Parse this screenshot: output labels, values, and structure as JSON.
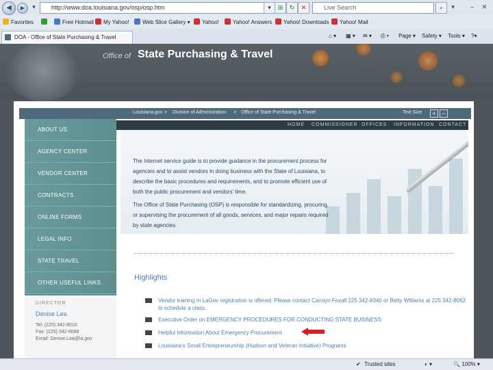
{
  "browser": {
    "url": "http://www.doa.louisiana.gov/osp/osp.htm",
    "search_placeholder": "Live Search",
    "favorites_label": "Favorites",
    "favorites": [
      "Free Hotmail",
      "My Yahoo!",
      "Web Slice Gallery",
      "Yahoo!",
      "Yahoo! Answers",
      "Yahoo! Downloads",
      "Yahoo! Mail"
    ],
    "tab_title": "DOA - Office of State Purchasing & Travel",
    "tools": [
      "Page",
      "Safety",
      "Tools"
    ],
    "status_zone": "Trusted sites",
    "zoom": "100%"
  },
  "header": {
    "office_of": "Office of",
    "title": "State Purchasing & Travel"
  },
  "breadcrumb": [
    "Louisiana.gov",
    "Division of Administration",
    "Office of State Purchasing & Travel"
  ],
  "text_size_label": "Text Size",
  "topnav": [
    "HOME",
    "COMMISSIONER",
    "OFFICES",
    "INFORMATION",
    "CONTACT"
  ],
  "sidebar": [
    "ABOUT US",
    "AGENCY CENTER",
    "VENDOR CENTER",
    "CONTRACTS",
    "ONLINE FORMS",
    "LEGAL INFO",
    "STATE TRAVEL",
    "OTHER USEFUL LINKS"
  ],
  "director": {
    "label": "DIRECTOR",
    "name": "Denise Lea",
    "tel": "Tel: (225) 342-8010",
    "fax": "Fax: (225) 342-8688",
    "email": "Email: Denise.Lea@la.gov"
  },
  "intro": {
    "p1": "The Internet service guide is to provide guidance in the procurement process for agencies and to assist vendors in doing business with the State of Louisiana, to describe the basic procedures and requirements, and to promote efficient use of both the public procurement and vendors' time.",
    "p2": "The Office of State Purchasing (OSP) is responsible for standardizing, procuring, or supervising the procurement of all goods, services, and major repairs required by state agencies."
  },
  "highlights": {
    "title": "Highlights",
    "items": [
      "Vendor training in LaGov registration is offered. Please contact Carolyn Foxall 225 342-8340 or Betty Williams at 225 342-8062 to schedule a class.",
      "Executive Order on EMERGENCY PROCEDURES FOR CONDUCTING STATE BUSINESS",
      "Helpful Information About Emergency Procurement",
      "Louisiana's Small Entrepreneurship (Hudson and Veteran Initiative) Programs"
    ]
  },
  "colors": {
    "accent": "#4a7fb0",
    "sidebar": "#5f8e8f",
    "arrow": "#d0202a"
  }
}
